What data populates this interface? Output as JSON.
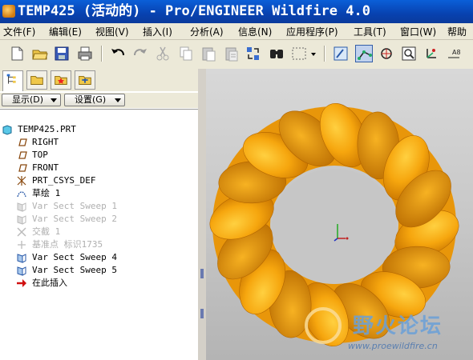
{
  "window": {
    "title": "TEMP425 (活动的) - Pro/ENGINEER Wildfire 4.0"
  },
  "menu": [
    {
      "label": "文件(F)"
    },
    {
      "label": "编辑(E)"
    },
    {
      "label": "视图(V)"
    },
    {
      "label": "插入(I)"
    },
    {
      "label": "分析(A)"
    },
    {
      "label": "信息(N)"
    },
    {
      "label": "应用程序(P)"
    },
    {
      "label": "工具(T)"
    },
    {
      "label": "窗口(W)"
    },
    {
      "label": "帮助"
    }
  ],
  "toolbar": {
    "icons": [
      "new-file-icon",
      "open-file-icon",
      "save-icon",
      "print-icon",
      "undo-icon",
      "redo-icon",
      "cut-icon",
      "copy-icon",
      "paste-icon",
      "paste-special-icon",
      "regenerate-icon",
      "find-icon",
      "select-box-icon",
      "dropdown-arrow-icon",
      "datum-plane-display-icon",
      "datum-axis-display-icon",
      "datum-point-display-icon",
      "zoom-icon",
      "csys-display-icon",
      "annotation-display-icon"
    ]
  },
  "panel": {
    "show_button": "显示(D)",
    "settings_button": "设置(G)"
  },
  "tree": {
    "items": [
      {
        "label": "TEMP425.PRT",
        "icon": "part-icon",
        "state": "normal"
      },
      {
        "label": "RIGHT",
        "icon": "datum-plane-icon",
        "state": "normal"
      },
      {
        "label": "TOP",
        "icon": "datum-plane-icon",
        "state": "normal"
      },
      {
        "label": "FRONT",
        "icon": "datum-plane-icon",
        "state": "normal"
      },
      {
        "label": "PRT_CSYS_DEF",
        "icon": "csys-icon",
        "state": "normal"
      },
      {
        "label": "草绘 1",
        "icon": "sketch-icon",
        "state": "normal"
      },
      {
        "label": "Var Sect Sweep 1",
        "icon": "sweep-icon",
        "state": "suppressed"
      },
      {
        "label": "Var Sect Sweep 2",
        "icon": "sweep-icon",
        "state": "suppressed"
      },
      {
        "label": "交截 1",
        "icon": "intersect-icon",
        "state": "suppressed"
      },
      {
        "label": "基准点 标识1735",
        "icon": "datum-point-icon",
        "state": "suppressed"
      },
      {
        "label": "Var Sect Sweep 4",
        "icon": "sweep-icon",
        "state": "normal"
      },
      {
        "label": "Var Sect Sweep 5",
        "icon": "sweep-icon",
        "state": "normal"
      },
      {
        "label": "在此插入",
        "icon": "insert-here-arrow-icon",
        "state": "normal"
      }
    ]
  },
  "viewport": {
    "model_color": "#f6a60e",
    "watermark_text": "野火论坛",
    "watermark_url": "www.proewildfire.cn"
  }
}
